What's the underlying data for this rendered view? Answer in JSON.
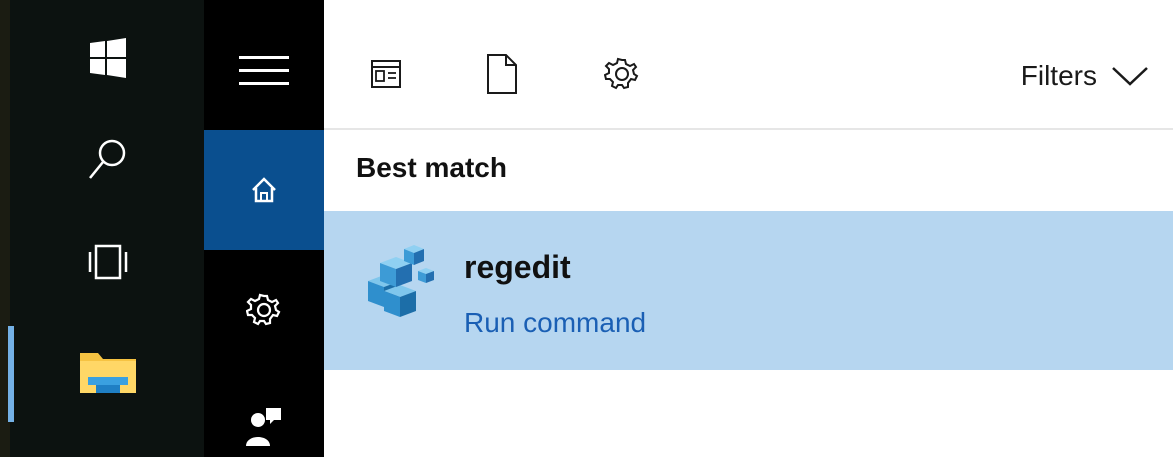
{
  "taskbar": {
    "icons": [
      "windows-logo-icon",
      "search-icon",
      "task-view-icon",
      "file-explorer-icon"
    ]
  },
  "rail": {
    "icons": [
      "hamburger-menu-icon",
      "home-icon",
      "gear-icon",
      "feedback-icon"
    ],
    "active": "home"
  },
  "toolbar": {
    "icons": [
      "apps-icon",
      "document-icon",
      "settings-icon"
    ],
    "filters_label": "Filters"
  },
  "results": {
    "heading": "Best match",
    "items": [
      {
        "title": "regedit",
        "subtitle": "Run command",
        "icon": "regedit-icon"
      }
    ]
  },
  "colors": {
    "taskbar_bg": "#0c1210",
    "rail_bg": "#000000",
    "rail_active": "#0a4f8f",
    "result_highlight": "#b6d6f0",
    "link_blue": "#1a5fb4"
  }
}
